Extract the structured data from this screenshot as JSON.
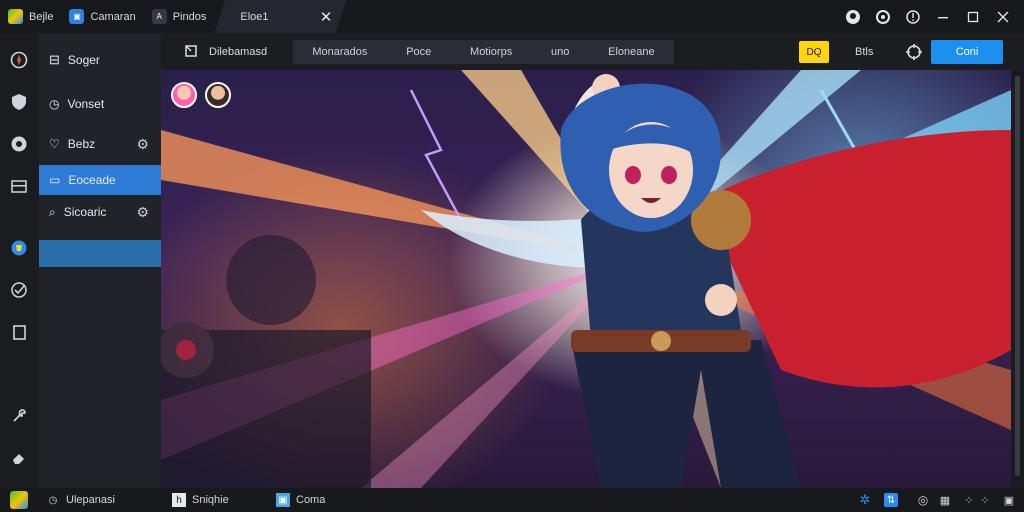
{
  "titlebar": {
    "tabs": [
      {
        "label": "Bejle"
      },
      {
        "label": "Camaran"
      },
      {
        "label": "Pindos"
      },
      {
        "label": "Eloe1"
      }
    ]
  },
  "sidebar": {
    "items": [
      {
        "label": "Soger"
      },
      {
        "label": "Vonset"
      },
      {
        "label": "Bebz"
      },
      {
        "label": "Eoceade"
      },
      {
        "label": "Sicoaric"
      }
    ]
  },
  "toolbar": {
    "title": "Dilebamasd",
    "tabs": [
      "Monarados",
      "Poce",
      "Motiorps",
      "uno",
      "Eloneane"
    ],
    "yellow_label": "DQ",
    "filter_label": "Btls",
    "primary_label": "Coni"
  },
  "statusbar": {
    "left_label": "Ulepanasi",
    "item1": "Sniqhie",
    "item2": "Coma"
  },
  "colors": {
    "accent": "#2e7cd6",
    "primary": "#1c8ff0",
    "highlight": "#ffd60a"
  }
}
